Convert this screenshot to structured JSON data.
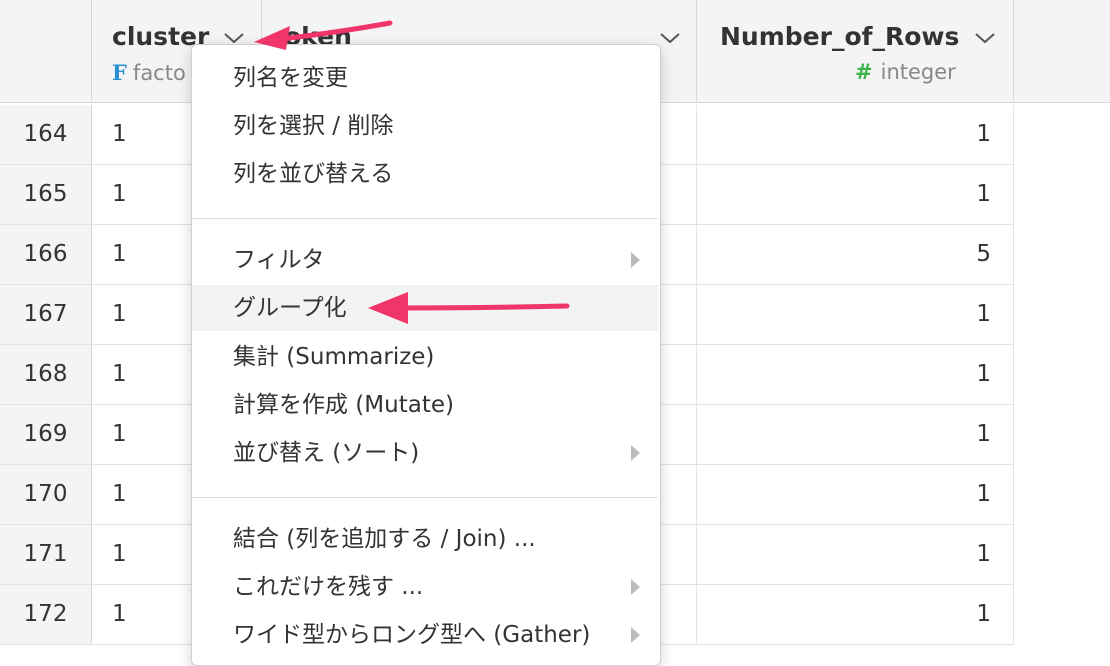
{
  "table": {
    "columns": [
      {
        "name": "cluster",
        "type_icon": "F",
        "type": "factor",
        "type_visible": "facto"
      },
      {
        "name": "token",
        "name_visible": "oken"
      },
      {
        "name": "Number_of_Rows",
        "type_icon": "#",
        "type": "integer"
      }
    ],
    "rows": [
      {
        "n": "164",
        "cluster": "1",
        "count": "1"
      },
      {
        "n": "165",
        "cluster": "1",
        "count": "1"
      },
      {
        "n": "166",
        "cluster": "1",
        "count": "5"
      },
      {
        "n": "167",
        "cluster": "1",
        "count": "1"
      },
      {
        "n": "168",
        "cluster": "1",
        "count": "1"
      },
      {
        "n": "169",
        "cluster": "1",
        "count": "1"
      },
      {
        "n": "170",
        "cluster": "1",
        "count": "1"
      },
      {
        "n": "171",
        "cluster": "1",
        "count": "1"
      },
      {
        "n": "172",
        "cluster": "1",
        "count": "1"
      }
    ]
  },
  "menu": {
    "items": [
      {
        "label": "列名を変更",
        "submenu": false
      },
      {
        "label": "列を選択 / 削除",
        "submenu": false
      },
      {
        "label": "列を並び替える",
        "submenu": false
      },
      {
        "label": "フィルタ",
        "submenu": true
      },
      {
        "label": "グループ化",
        "submenu": false,
        "active": true
      },
      {
        "label": "集計 (Summarize)",
        "submenu": false
      },
      {
        "label": "計算を作成 (Mutate)",
        "submenu": false
      },
      {
        "label": "並び替え (ソート)",
        "submenu": true
      },
      {
        "label": "結合 (列を追加する / Join) ...",
        "submenu": false
      },
      {
        "label": "これだけを残す ...",
        "submenu": true
      },
      {
        "label": "ワイド型からロング型へ (Gather)",
        "submenu": true
      }
    ]
  },
  "colors": {
    "annotation_arrow": "#f0356b",
    "factor_icon": "#2a8fd0",
    "integer_icon": "#3bb54a"
  }
}
